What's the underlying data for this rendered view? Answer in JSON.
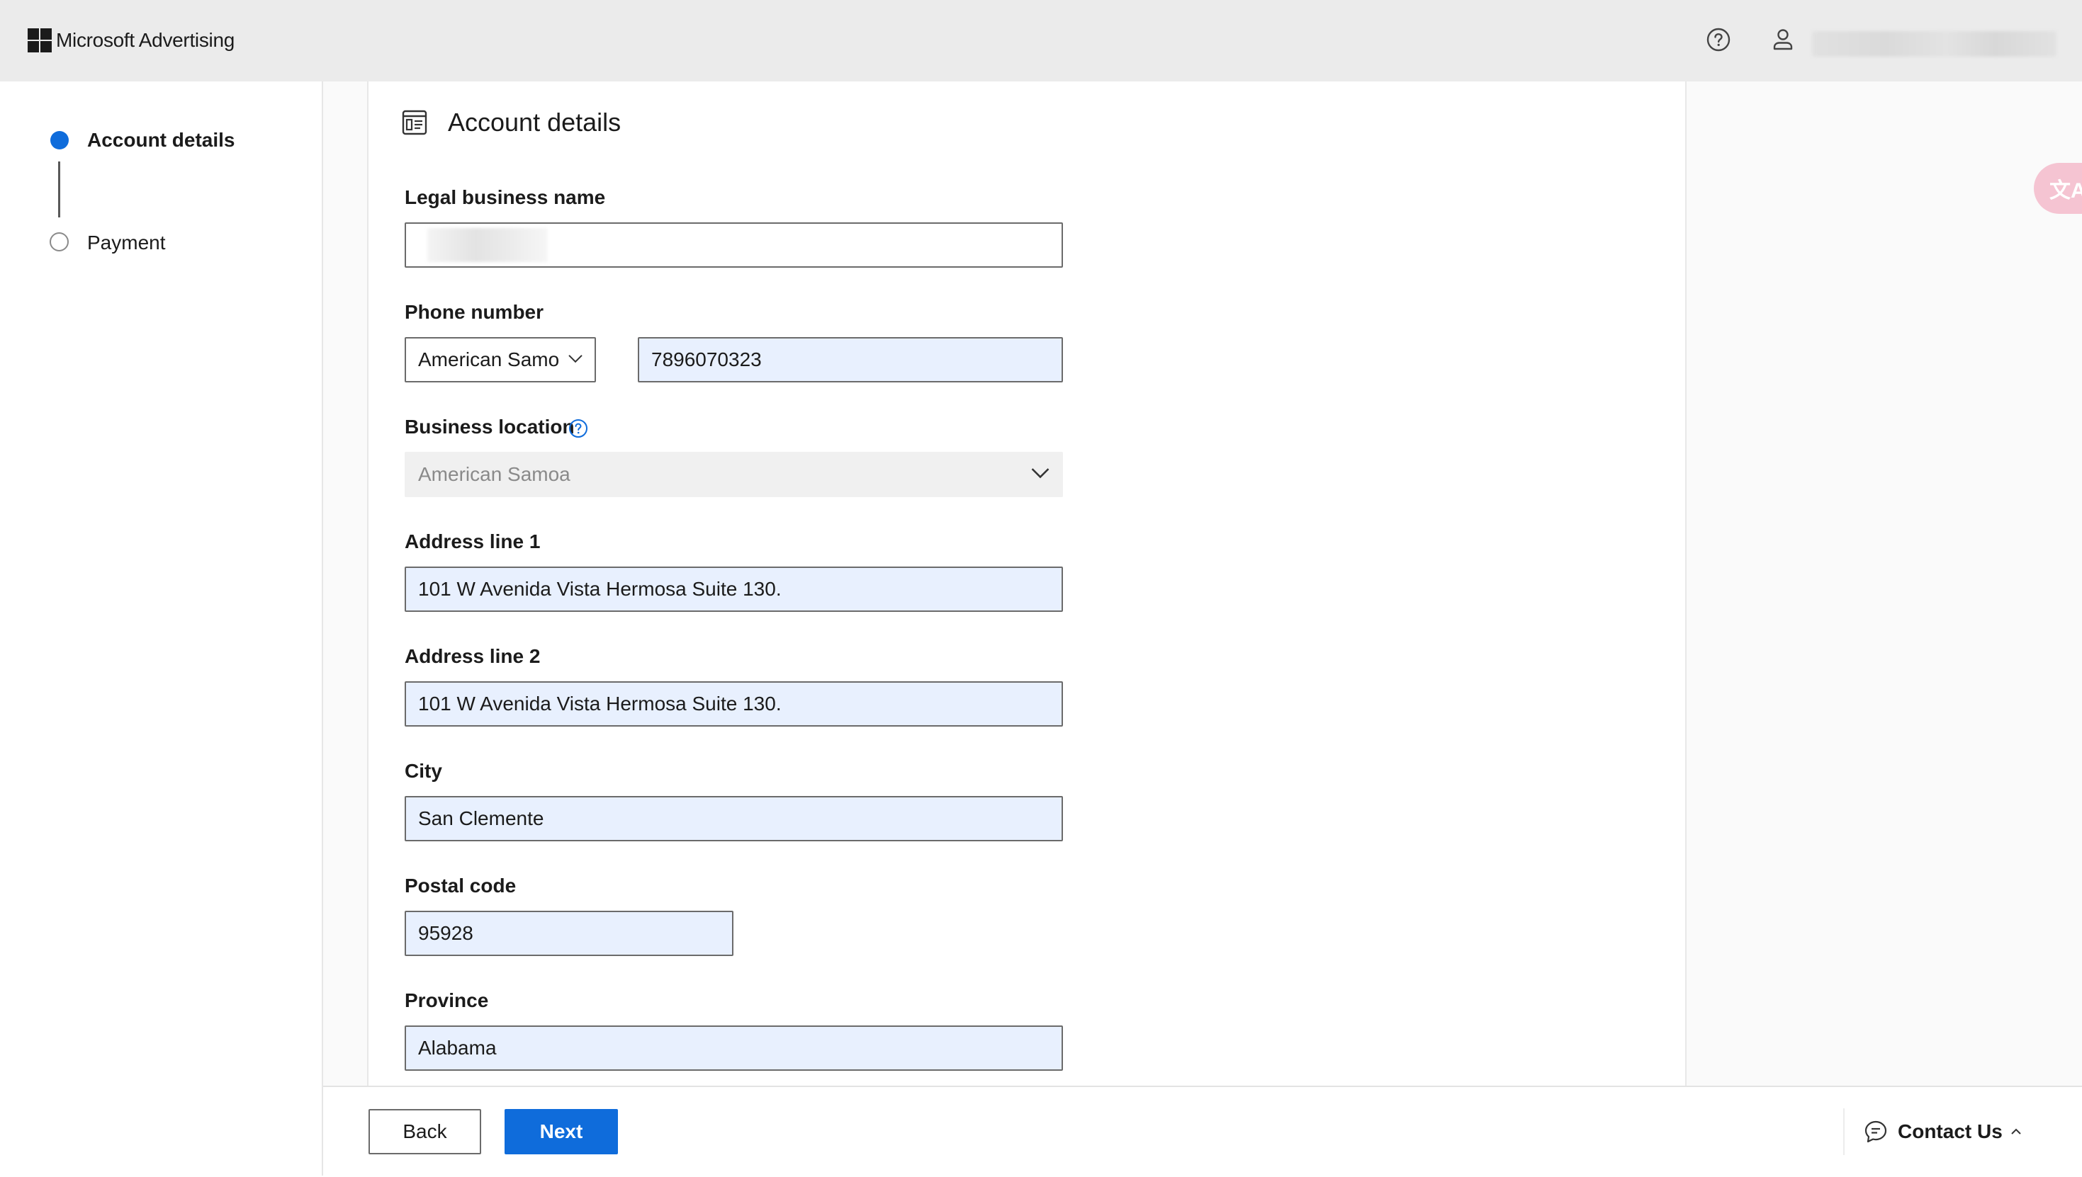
{
  "app": {
    "brand": "Microsoft Advertising"
  },
  "header": {
    "help_icon": "help-circle-icon",
    "user_icon": "person-icon"
  },
  "steps": [
    {
      "label": "Account details",
      "state": "active"
    },
    {
      "label": "Payment",
      "state": "pending"
    }
  ],
  "form": {
    "title": "Account details",
    "legal_business_name": {
      "label": "Legal business name",
      "value": ""
    },
    "phone": {
      "label": "Phone number",
      "country": "American Samo",
      "number": "7896070323"
    },
    "business_location": {
      "label": "Business location",
      "value": "American Samoa"
    },
    "address1": {
      "label": "Address line 1",
      "value": "101 W Avenida Vista Hermosa Suite 130."
    },
    "address2": {
      "label": "Address line 2",
      "value": "101 W Avenida Vista Hermosa Suite 130."
    },
    "city": {
      "label": "City",
      "value": "San Clemente"
    },
    "postal": {
      "label": "Postal code",
      "value": "95928"
    },
    "province": {
      "label": "Province",
      "value": "Alabama"
    }
  },
  "footer": {
    "back": "Back",
    "next": "Next",
    "contact": "Contact Us"
  },
  "translate_badge": "文A",
  "colors": {
    "accent": "#0f6cdb",
    "autofill": "#e8f0fe",
    "topbar": "#ebebeb"
  }
}
